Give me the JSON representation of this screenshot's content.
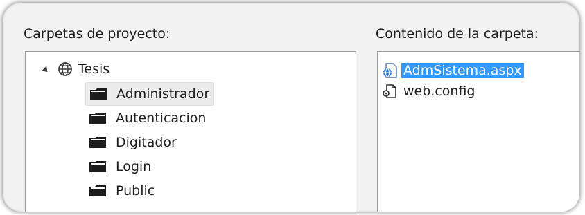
{
  "left_pane": {
    "title": "Carpetas de proyecto:",
    "root": {
      "label": "Tesis",
      "icon": "globe-icon"
    },
    "folders": [
      {
        "label": "Administrador",
        "selected": true
      },
      {
        "label": "Autenticacion",
        "selected": false
      },
      {
        "label": "Digitador",
        "selected": false
      },
      {
        "label": "Login",
        "selected": false
      },
      {
        "label": "Public",
        "selected": false
      }
    ]
  },
  "right_pane": {
    "title": "Contenido de la carpeta:",
    "files": [
      {
        "label": "AdmSistema.aspx",
        "icon": "aspx-file-icon",
        "selected": true
      },
      {
        "label": "web.config",
        "icon": "config-file-icon",
        "selected": false
      }
    ]
  },
  "colors": {
    "selection": "#3399ff",
    "tree_selection": "#ececec"
  }
}
